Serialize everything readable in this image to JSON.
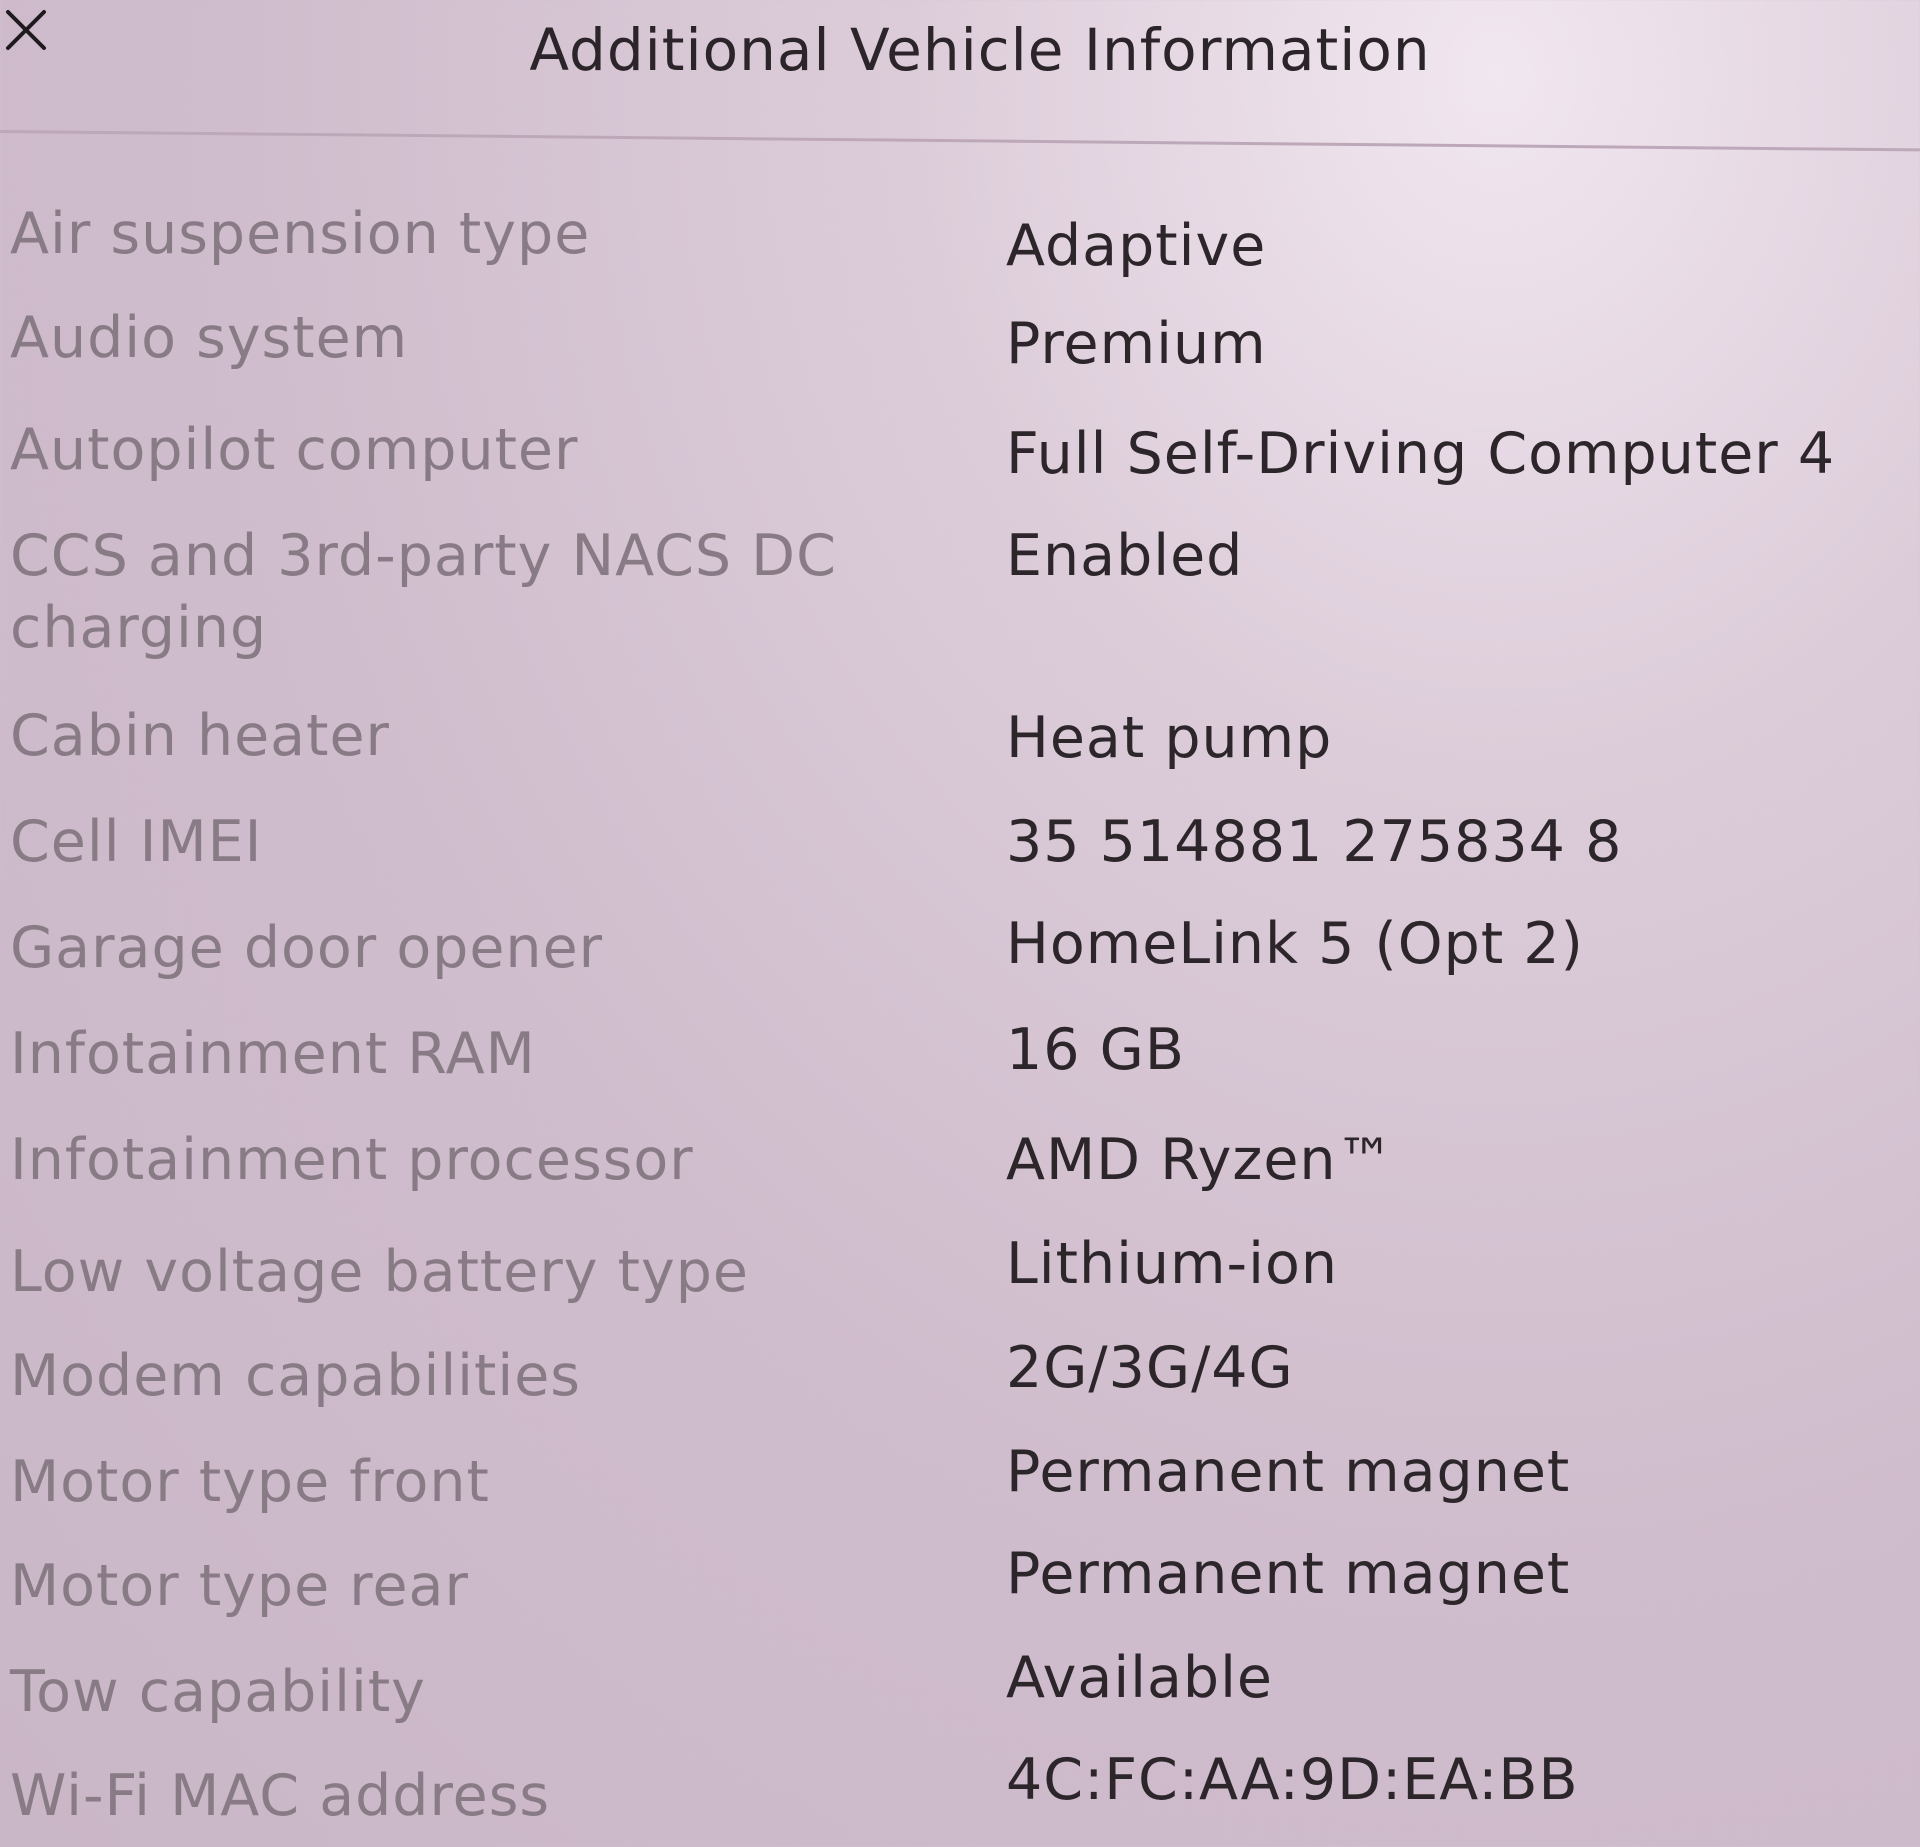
{
  "header": {
    "title": "Additional Vehicle Information",
    "close_icon": "close-icon"
  },
  "rows": [
    {
      "label": "Air suspension type",
      "value": "Adaptive"
    },
    {
      "label": "Audio system",
      "value": "Premium"
    },
    {
      "label": "Autopilot computer",
      "value": "Full Self-Driving Computer 4"
    },
    {
      "label": "CCS and 3rd-party NACS DC charging",
      "value": "Enabled"
    },
    {
      "label": "Cabin heater",
      "value": "Heat pump"
    },
    {
      "label": "Cell IMEI",
      "value": "35 514881 275834 8"
    },
    {
      "label": "Garage door opener",
      "value": "HomeLink 5 (Opt 2)"
    },
    {
      "label": "Infotainment RAM",
      "value": "16 GB"
    },
    {
      "label": "Infotainment processor",
      "value": "AMD Ryzen™"
    },
    {
      "label": "Low voltage battery type",
      "value": "Lithium-ion"
    },
    {
      "label": "Modem capabilities",
      "value": "2G/3G/4G"
    },
    {
      "label": "Motor type front",
      "value": "Permanent magnet"
    },
    {
      "label": "Motor type rear",
      "value": "Permanent magnet"
    },
    {
      "label": "Tow capability",
      "value": "Available"
    },
    {
      "label": "Wi-Fi MAC address",
      "value": "4C:FC:AA:9D:EA:BB"
    }
  ]
}
